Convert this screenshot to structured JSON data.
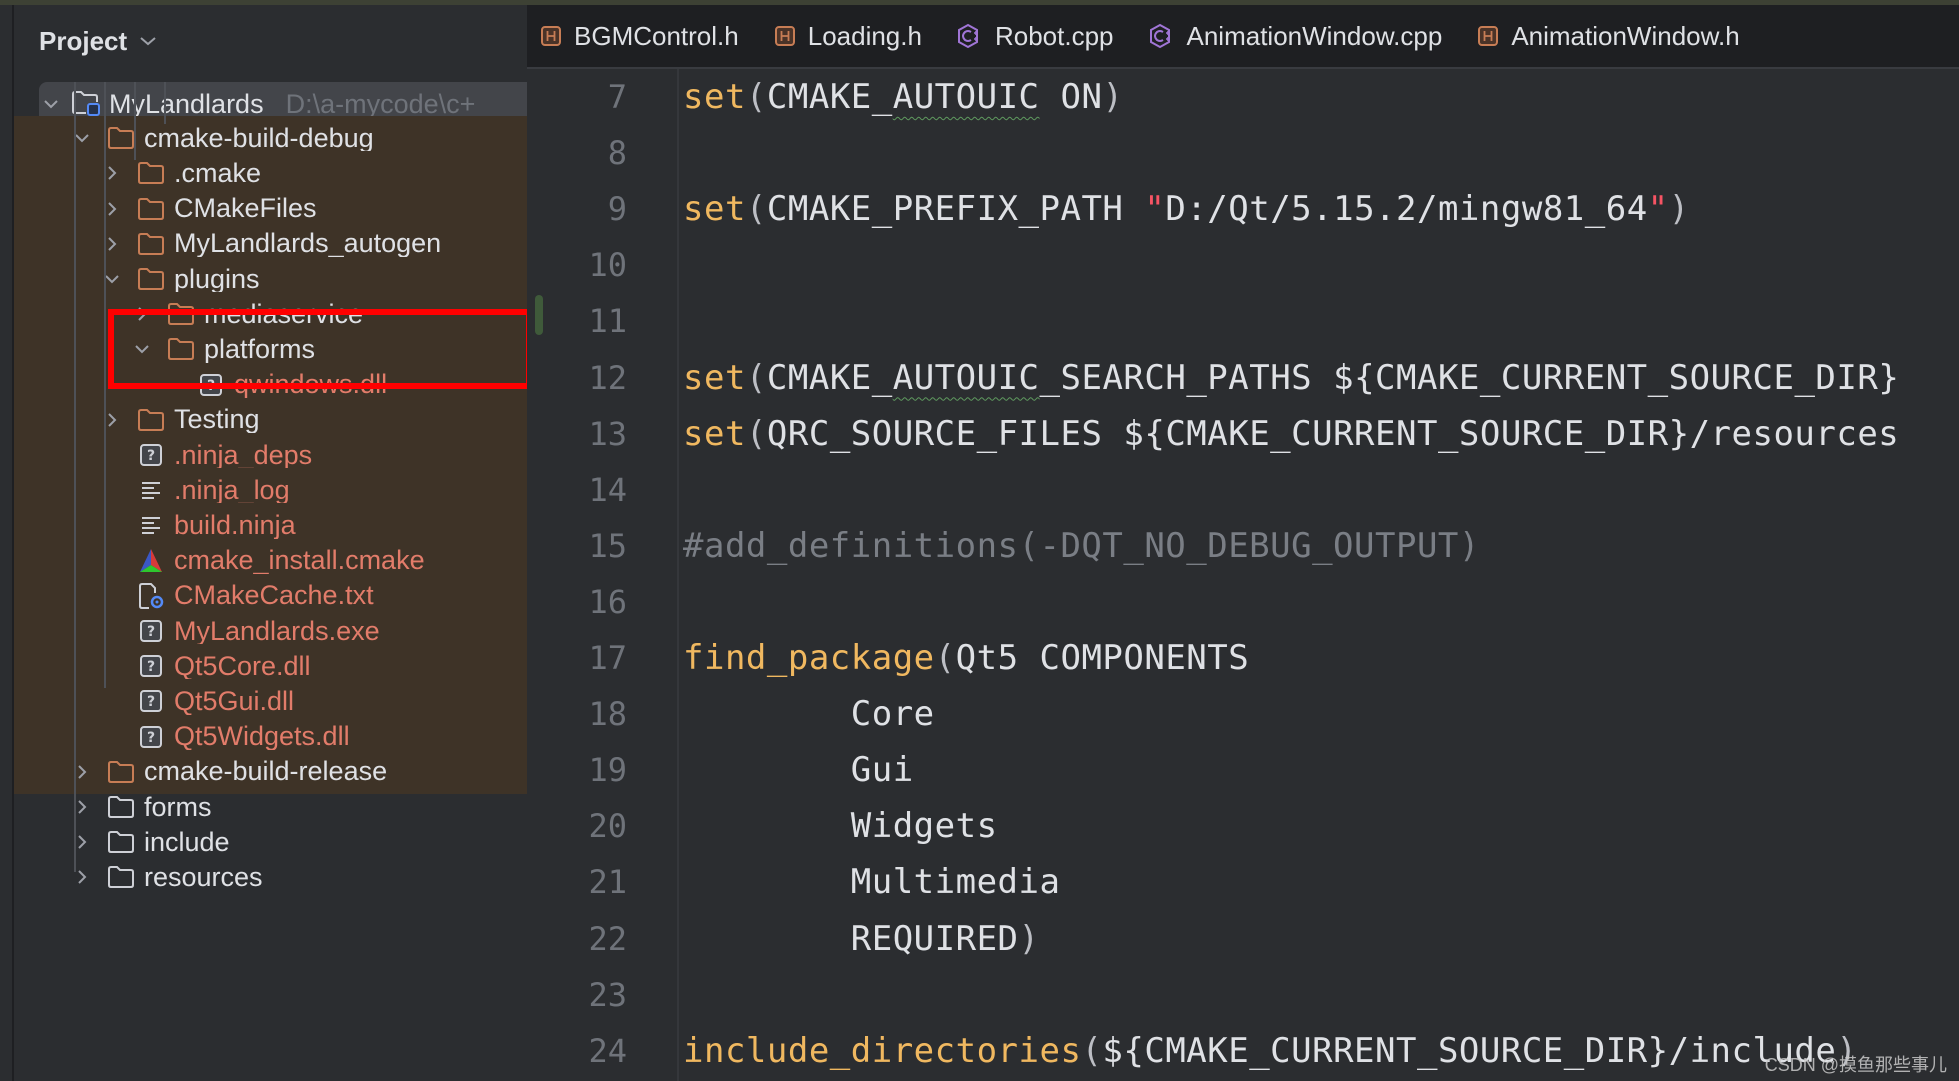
{
  "project_panel": {
    "title": "Project",
    "root": {
      "name": "MyLandlards",
      "path": "D:\\a-mycode\\c+"
    },
    "tree": [
      {
        "label": "cmake-build-debug",
        "type": "folder",
        "depth": 1,
        "expanded": true,
        "excluded": true,
        "ignored": false
      },
      {
        "label": ".cmake",
        "type": "folder",
        "depth": 2,
        "expanded": false,
        "excluded": true,
        "ignored": false
      },
      {
        "label": "CMakeFiles",
        "type": "folder",
        "depth": 2,
        "expanded": false,
        "excluded": true,
        "ignored": false
      },
      {
        "label": "MyLandlards_autogen",
        "type": "folder",
        "depth": 2,
        "expanded": false,
        "excluded": true,
        "ignored": false
      },
      {
        "label": "plugins",
        "type": "folder",
        "depth": 2,
        "expanded": true,
        "excluded": true,
        "ignored": false
      },
      {
        "label": "mediaservice",
        "type": "folder",
        "depth": 3,
        "expanded": false,
        "excluded": true,
        "ignored": false,
        "highlighted": true
      },
      {
        "label": "platforms",
        "type": "folder",
        "depth": 3,
        "expanded": true,
        "excluded": true,
        "ignored": false
      },
      {
        "label": "qwindows.dll",
        "type": "unknown-file",
        "depth": 4,
        "excluded": true,
        "ignored": true
      },
      {
        "label": "Testing",
        "type": "folder",
        "depth": 2,
        "expanded": false,
        "excluded": true,
        "ignored": false
      },
      {
        "label": ".ninja_deps",
        "type": "unknown-file",
        "depth": 2,
        "excluded": true,
        "ignored": true
      },
      {
        "label": ".ninja_log",
        "type": "text-file",
        "depth": 2,
        "excluded": true,
        "ignored": true
      },
      {
        "label": "build.ninja",
        "type": "text-file",
        "depth": 2,
        "excluded": true,
        "ignored": true
      },
      {
        "label": "cmake_install.cmake",
        "type": "cmake-file",
        "depth": 2,
        "excluded": true,
        "ignored": true
      },
      {
        "label": "CMakeCache.txt",
        "type": "settings-file",
        "depth": 2,
        "excluded": true,
        "ignored": true
      },
      {
        "label": "MyLandlards.exe",
        "type": "unknown-file",
        "depth": 2,
        "excluded": true,
        "ignored": true
      },
      {
        "label": "Qt5Core.dll",
        "type": "unknown-file",
        "depth": 2,
        "excluded": true,
        "ignored": true
      },
      {
        "label": "Qt5Gui.dll",
        "type": "unknown-file",
        "depth": 2,
        "excluded": true,
        "ignored": true
      },
      {
        "label": "Qt5Widgets.dll",
        "type": "unknown-file",
        "depth": 2,
        "excluded": true,
        "ignored": true
      },
      {
        "label": "cmake-build-release",
        "type": "folder",
        "depth": 1,
        "expanded": false,
        "excluded": true,
        "ignored": false
      },
      {
        "label": "forms",
        "type": "folder",
        "depth": 1,
        "expanded": false,
        "excluded": false,
        "ignored": false
      },
      {
        "label": "include",
        "type": "folder",
        "depth": 1,
        "expanded": false,
        "excluded": false,
        "ignored": false
      },
      {
        "label": "resources",
        "type": "folder",
        "depth": 1,
        "expanded": false,
        "excluded": false,
        "ignored": false
      }
    ]
  },
  "editor": {
    "tabs": [
      {
        "label": "BGMControl.h",
        "icon": "header-file-icon"
      },
      {
        "label": "Loading.h",
        "icon": "header-file-icon"
      },
      {
        "label": "Robot.cpp",
        "icon": "cpp-file-icon"
      },
      {
        "label": "AnimationWindow.cpp",
        "icon": "cpp-file-icon"
      },
      {
        "label": "AnimationWindow.h",
        "icon": "header-file-icon"
      }
    ],
    "lines": [
      {
        "n": "7",
        "tokens": [
          [
            "fn",
            "set"
          ],
          [
            "paren",
            "("
          ],
          [
            "txt",
            "CMAKE_"
          ],
          [
            "squig",
            "AUTOUIC"
          ],
          [
            "txt",
            " ON"
          ],
          [
            "paren",
            ")"
          ]
        ]
      },
      {
        "n": "8",
        "tokens": []
      },
      {
        "n": "9",
        "tokens": [
          [
            "fn",
            "set"
          ],
          [
            "paren",
            "("
          ],
          [
            "txt",
            "CMAKE_PREFIX_PATH "
          ],
          [
            "str",
            "\""
          ],
          [
            "txt",
            "D:/Qt/5.15.2/mingw81_64"
          ],
          [
            "str",
            "\""
          ],
          [
            "paren",
            ")"
          ]
        ]
      },
      {
        "n": "10",
        "tokens": []
      },
      {
        "n": "11",
        "tokens": [],
        "changed": true
      },
      {
        "n": "12",
        "tokens": [
          [
            "fn",
            "set"
          ],
          [
            "paren",
            "("
          ],
          [
            "txt",
            "CMAKE_"
          ],
          [
            "squig",
            "AUTOUIC"
          ],
          [
            "txt",
            "_SEARCH_PATHS ${CMAKE_CURRENT_SOURCE_DIR}"
          ]
        ]
      },
      {
        "n": "13",
        "tokens": [
          [
            "fn",
            "set"
          ],
          [
            "paren",
            "("
          ],
          [
            "txt",
            "QRC_SOURCE_FILES ${CMAKE_CURRENT_SOURCE_DIR}/resources"
          ]
        ]
      },
      {
        "n": "14",
        "tokens": []
      },
      {
        "n": "15",
        "tokens": [
          [
            "cmt",
            "#add_definitions(-DQT_NO_DEBUG_OUTPUT)"
          ]
        ]
      },
      {
        "n": "16",
        "tokens": []
      },
      {
        "n": "17",
        "tokens": [
          [
            "fn",
            "find_package"
          ],
          [
            "paren",
            "("
          ],
          [
            "txt",
            "Qt5 COMPONENTS"
          ]
        ]
      },
      {
        "n": "18",
        "tokens": [
          [
            "txt",
            "        Core"
          ]
        ]
      },
      {
        "n": "19",
        "tokens": [
          [
            "txt",
            "        Gui"
          ]
        ]
      },
      {
        "n": "20",
        "tokens": [
          [
            "txt",
            "        Widgets"
          ]
        ]
      },
      {
        "n": "21",
        "tokens": [
          [
            "txt",
            "        Multimedia"
          ]
        ]
      },
      {
        "n": "22",
        "tokens": [
          [
            "txt",
            "        REQUIRED"
          ],
          [
            "paren",
            ")"
          ]
        ]
      },
      {
        "n": "23",
        "tokens": []
      },
      {
        "n": "24",
        "tokens": [
          [
            "fn",
            "include_directories"
          ],
          [
            "paren",
            "("
          ],
          [
            "txt",
            "${CMAKE_CURRENT_SOURCE_DIR}/include"
          ],
          [
            "paren",
            ")"
          ]
        ]
      }
    ]
  },
  "watermark": "CSDN @摸鱼那些事儿",
  "colors": {
    "excluded_bg": "#3e3327",
    "ignored_text": "#e27c6a",
    "keyword_fn": "#f0b860",
    "highlight_box": "#ff0000"
  }
}
